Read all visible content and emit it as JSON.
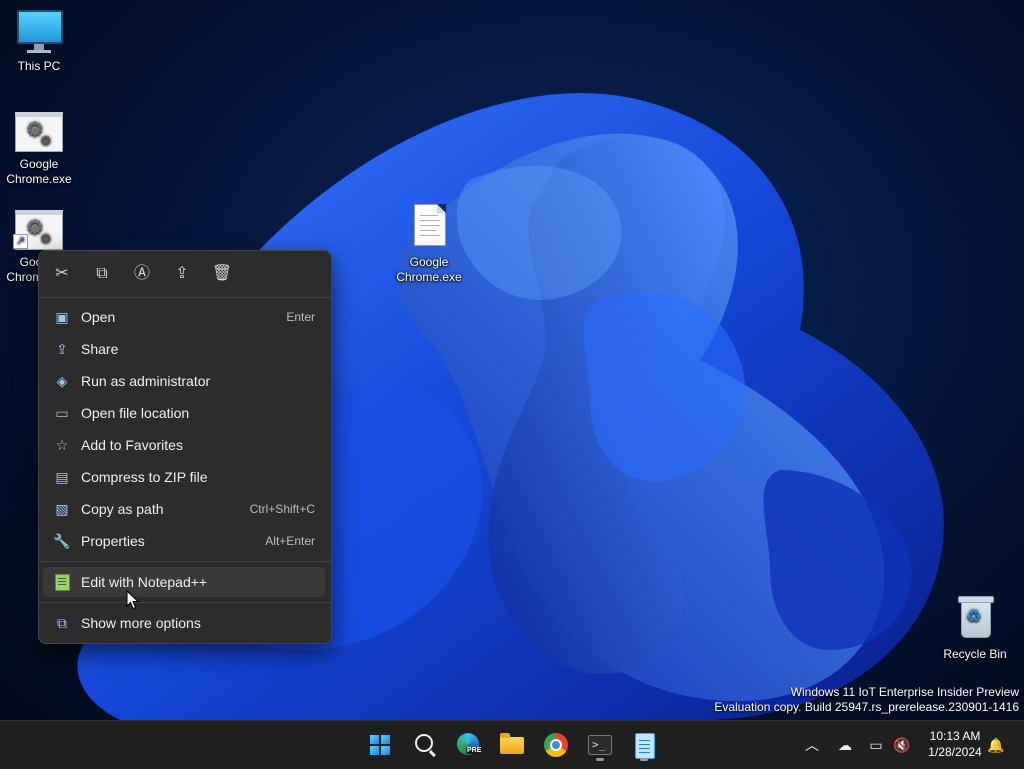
{
  "desktop": {
    "icons": [
      {
        "name": "this-pc",
        "label": "This PC"
      },
      {
        "name": "chrome-exe-1",
        "label": "Google Chrome.exe"
      },
      {
        "name": "chrome-exe-shortcut",
        "label": "Google Chrome.exe"
      },
      {
        "name": "chrome-exe-2",
        "label": "Google Chrome.exe"
      },
      {
        "name": "recycle-bin",
        "label": "Recycle Bin"
      }
    ],
    "shortcut_label_visible": "Goog Chron"
  },
  "watermark": {
    "line1": "Windows 11 IoT Enterprise Insider Preview",
    "line2": "Evaluation copy. Build 25947.rs_prerelease.230901-1416"
  },
  "context_menu": {
    "toolbar": [
      "cut",
      "copy",
      "rename",
      "share",
      "delete"
    ],
    "items": [
      {
        "label": "Open",
        "shortcut": "Enter",
        "icon": "open-icon"
      },
      {
        "label": "Share",
        "shortcut": "",
        "icon": "share-icon"
      },
      {
        "label": "Run as administrator",
        "shortcut": "",
        "icon": "shield-icon"
      },
      {
        "label": "Open file location",
        "shortcut": "",
        "icon": "folder-icon"
      },
      {
        "label": "Add to Favorites",
        "shortcut": "",
        "icon": "star-icon"
      },
      {
        "label": "Compress to ZIP file",
        "shortcut": "",
        "icon": "zip-icon"
      },
      {
        "label": "Copy as path",
        "shortcut": "Ctrl+Shift+C",
        "icon": "path-icon"
      },
      {
        "label": "Properties",
        "shortcut": "Alt+Enter",
        "icon": "wrench-icon"
      },
      {
        "label": "Edit with Notepad++",
        "shortcut": "",
        "icon": "notepadpp-icon"
      },
      {
        "label": "Show more options",
        "shortcut": "",
        "icon": "more-options-icon"
      }
    ]
  },
  "taskbar": {
    "apps": [
      "start",
      "search",
      "edge-preview",
      "file-explorer",
      "chrome",
      "terminal",
      "notepad"
    ],
    "edge_badge": "PRE",
    "clock": {
      "time": "10:13 AM",
      "date": "1/28/2024"
    }
  },
  "colors": {
    "accent": "#0a5fe0",
    "menu_bg": "#2c2c2c",
    "taskbar_bg": "#1f1f1f"
  }
}
